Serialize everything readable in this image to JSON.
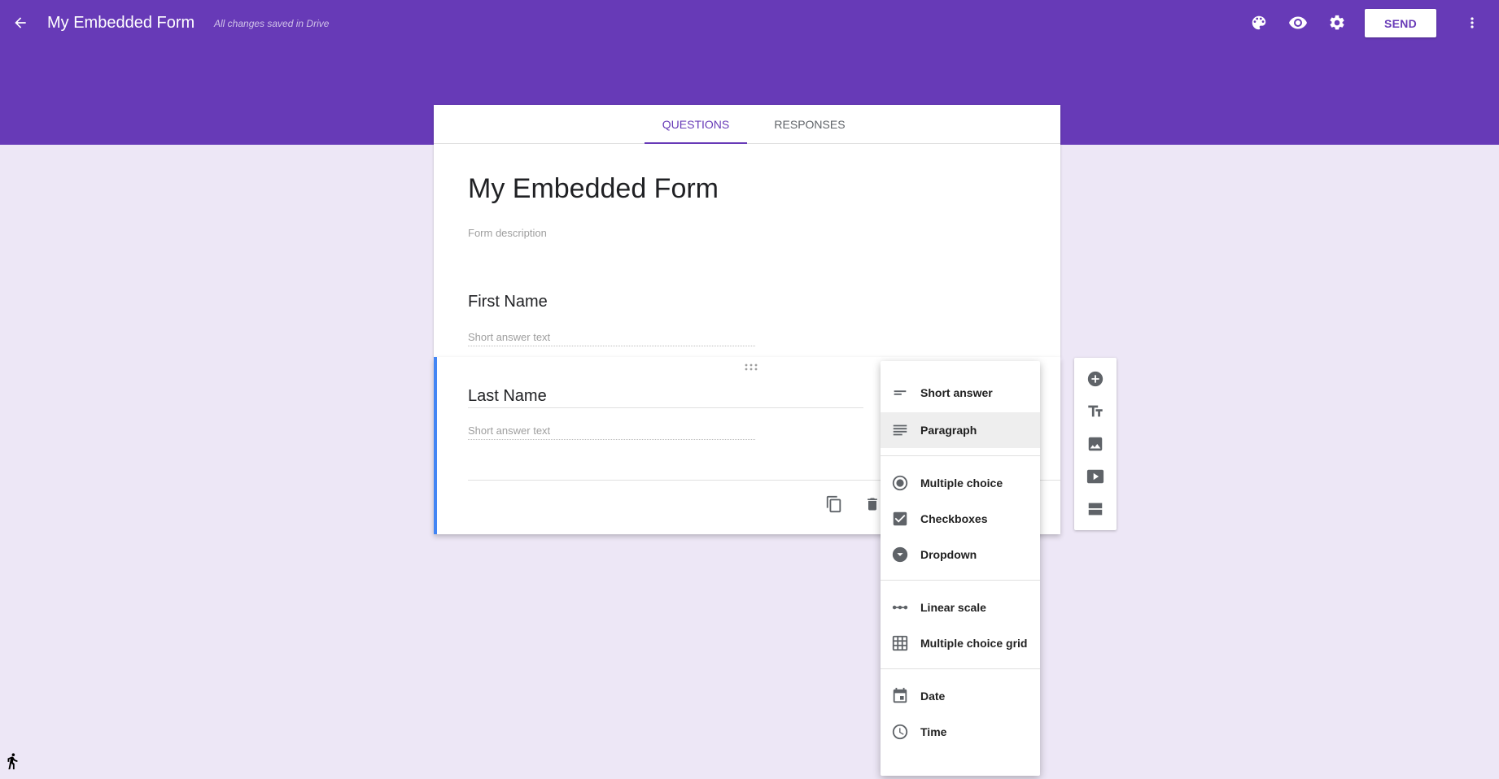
{
  "header": {
    "title": "My Embedded Form",
    "save_status": "All changes saved in Drive",
    "send_label": "SEND",
    "icons": [
      "back-arrow-icon",
      "palette-icon",
      "preview-eye-icon",
      "settings-gear-icon",
      "more-vert-icon"
    ]
  },
  "tabs": [
    {
      "label": "QUESTIONS",
      "active": true
    },
    {
      "label": "RESPONSES",
      "active": false
    }
  ],
  "form": {
    "title": "My Embedded Form",
    "description_placeholder": "Form description"
  },
  "questions": [
    {
      "title": "First Name",
      "answer_placeholder": "Short answer text"
    },
    {
      "title": "Last Name",
      "answer_placeholder": "Short answer text",
      "selected": true
    }
  ],
  "side_toolbar": {
    "icons": [
      "add-question-icon",
      "add-title-icon",
      "add-image-icon",
      "add-video-icon",
      "add-section-icon"
    ]
  },
  "question_type_menu": {
    "groups": [
      [
        {
          "label": "Short answer",
          "icon": "short-answer-icon"
        },
        {
          "label": "Paragraph",
          "icon": "paragraph-icon",
          "highlighted": true
        }
      ],
      [
        {
          "label": "Multiple choice",
          "icon": "radio-icon"
        },
        {
          "label": "Checkboxes",
          "icon": "checkbox-icon"
        },
        {
          "label": "Dropdown",
          "icon": "dropdown-icon"
        }
      ],
      [
        {
          "label": "Linear scale",
          "icon": "linear-scale-icon"
        },
        {
          "label": "Multiple choice grid",
          "icon": "grid-icon"
        }
      ],
      [
        {
          "label": "Date",
          "icon": "calendar-icon"
        },
        {
          "label": "Time",
          "icon": "clock-icon"
        }
      ]
    ]
  },
  "colors": {
    "brand": "#673ab7",
    "background": "#ede7f6",
    "active_question_border": "#4285f4"
  }
}
